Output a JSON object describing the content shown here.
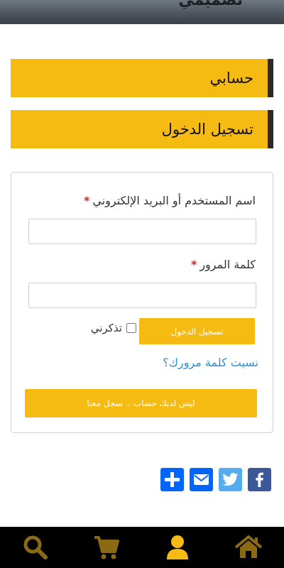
{
  "header": {
    "logo_text": "تصميمي"
  },
  "sections": {
    "account_title": "حسابي",
    "login_title": "تسجيل الدخول"
  },
  "form": {
    "username_label": "اسم المستخدم أو البريد الإلكتروني",
    "username_required": "*",
    "username_value": "",
    "password_label": "كلمة المرور",
    "password_required": "*",
    "password_value": "",
    "login_button": "تسجيل الدخول",
    "remember_label": "تذكرني",
    "remember_checked": false,
    "forgot_link": "نسيت كلمة مرورك؟",
    "register_button": "ليس لديك حساب .. سجل معنا"
  },
  "share": {
    "icons": [
      "facebook-icon",
      "twitter-icon",
      "email-icon",
      "plus-icon"
    ],
    "colors": {
      "facebook": "#3b5998",
      "twitter": "#55acee",
      "email": "#0166ff",
      "more": "#0166ff"
    }
  },
  "bottom_nav": {
    "icons": [
      "search-icon",
      "cart-icon",
      "user-icon",
      "home-icon"
    ],
    "active": "user-icon",
    "accent_color": "#f5bb12",
    "inactive_color": "#8a6a12"
  },
  "colors": {
    "accent": "#f5bb12",
    "bar_edge": "#2a2a2a",
    "link": "#2f8fcf"
  }
}
